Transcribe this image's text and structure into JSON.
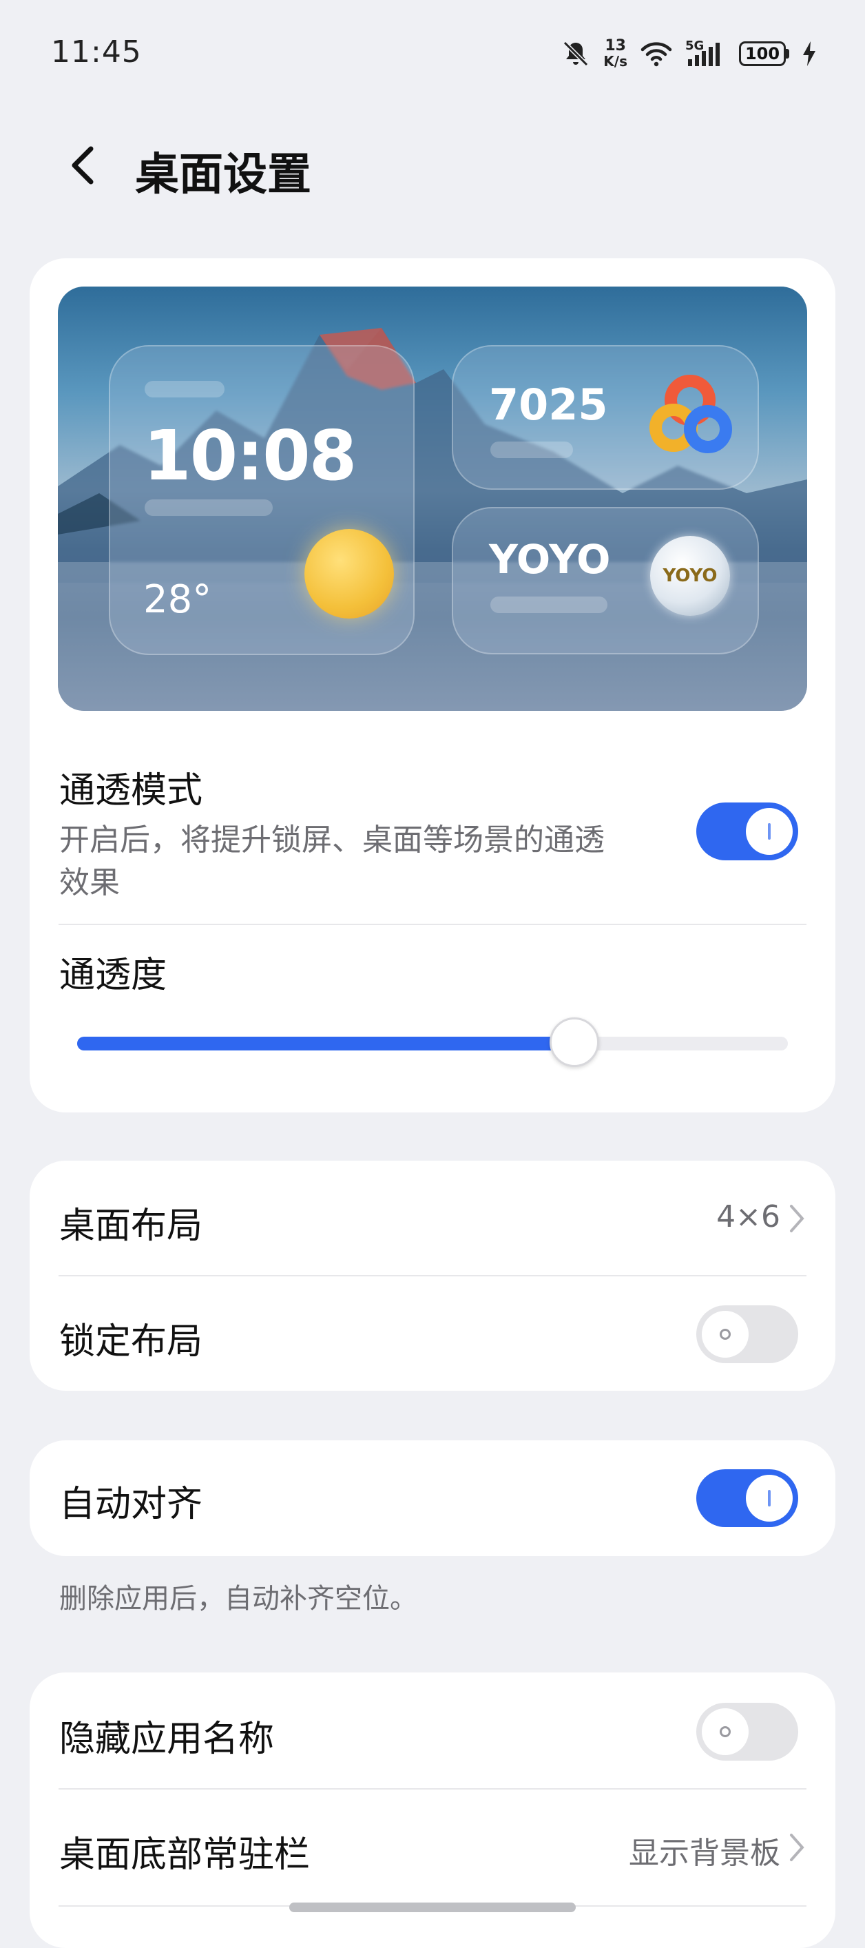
{
  "status_bar": {
    "time": "11:45",
    "net_speed_value": "13",
    "net_speed_unit": "K/s",
    "signal_label": "5G",
    "battery": "100"
  },
  "header": {
    "title": "桌面设置"
  },
  "preview": {
    "clock_time": "10:08",
    "temperature": "28°",
    "steps": "7025",
    "yoyo_label": "YOYO",
    "yoyo_badge": "YOYO"
  },
  "transparency": {
    "mode_title": "通透模式",
    "mode_desc_line1": "开启后，将提升锁屏、桌面等场景的通透",
    "mode_desc_line2": "效果",
    "mode_enabled": true,
    "level_title": "通透度",
    "level_fraction": 0.7
  },
  "layout": {
    "desktop_layout_label": "桌面布局",
    "desktop_layout_value": "4×6",
    "lock_layout_label": "锁定布局",
    "lock_layout_enabled": false
  },
  "align": {
    "auto_align_label": "自动对齐",
    "auto_align_enabled": true,
    "footnote": "删除应用后，自动补齐空位。"
  },
  "names": {
    "hide_names_label": "隐藏应用名称",
    "hide_names_enabled": false,
    "dock_label": "桌面底部常驻栏",
    "dock_value": "显示背景板"
  },
  "colors": {
    "accent": "#2f67f0",
    "background": "#eff0f4",
    "card": "#ffffff"
  }
}
